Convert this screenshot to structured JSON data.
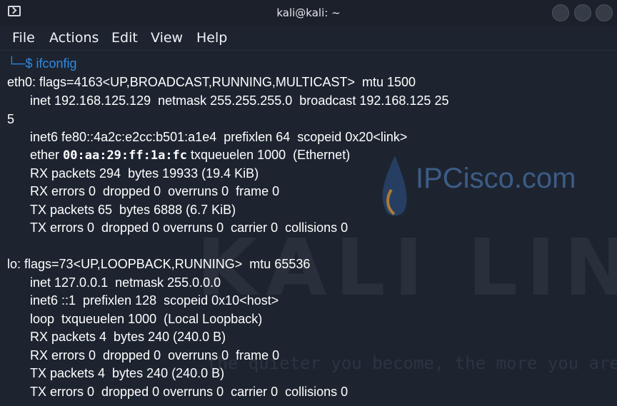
{
  "window": {
    "title": "kali@kali: ~"
  },
  "menu": {
    "items": [
      "File",
      "Actions",
      "Edit",
      "View",
      "Help"
    ]
  },
  "brand": {
    "name": "IPCisco.com"
  },
  "watermark": {
    "text": "KALI LINUX",
    "tagline": "the quieter you become, the more you are able"
  },
  "terminal": {
    "prompt_line": "└─$ ifconfig",
    "eth0": {
      "header": "eth0: flags=4163<UP,BROADCAST,RUNNING,MULTICAST>  mtu 1500",
      "inet": "inet 192.168.125.129  netmask 255.255.255.0  broadcast 192.168.125 25",
      "inet_wrap": "5",
      "inet6": "inet6 fe80::4a2c:e2cc:b501:a1e4  prefixlen 64  scopeid 0x20<link>",
      "ether_label": "ether ",
      "ether_mac": "00:aa:29:ff:1a:fc",
      "ether_rest": " txqueuelen 1000  (Ethernet)",
      "rx_packets": "RX packets 294  bytes 19933 (19.4 KiB)",
      "rx_errors": "RX errors 0  dropped 0  overruns 0  frame 0",
      "tx_packets": "TX packets 65  bytes 6888 (6.7 KiB)",
      "tx_errors": "TX errors 0  dropped 0 overruns 0  carrier 0  collisions 0"
    },
    "lo": {
      "header": "lo: flags=73<UP,LOOPBACK,RUNNING>  mtu 65536",
      "inet": "inet 127.0.0.1  netmask 255.0.0.0",
      "inet6": "inet6 ::1  prefixlen 128  scopeid 0x10<host>",
      "loop": "loop  txqueuelen 1000  (Local Loopback)",
      "rx_packets": "RX packets 4  bytes 240 (240.0 B)",
      "rx_errors": "RX errors 0  dropped 0  overruns 0  frame 0",
      "tx_packets": "TX packets 4  bytes 240 (240.0 B)",
      "tx_errors": "TX errors 0  dropped 0 overruns 0  carrier 0  collisions 0"
    }
  },
  "colors": {
    "background": "#1d2430",
    "titlebar": "#1b202a",
    "prompt": "#2e8be6",
    "text": "#ffffff",
    "brand": "#3d5c86"
  }
}
